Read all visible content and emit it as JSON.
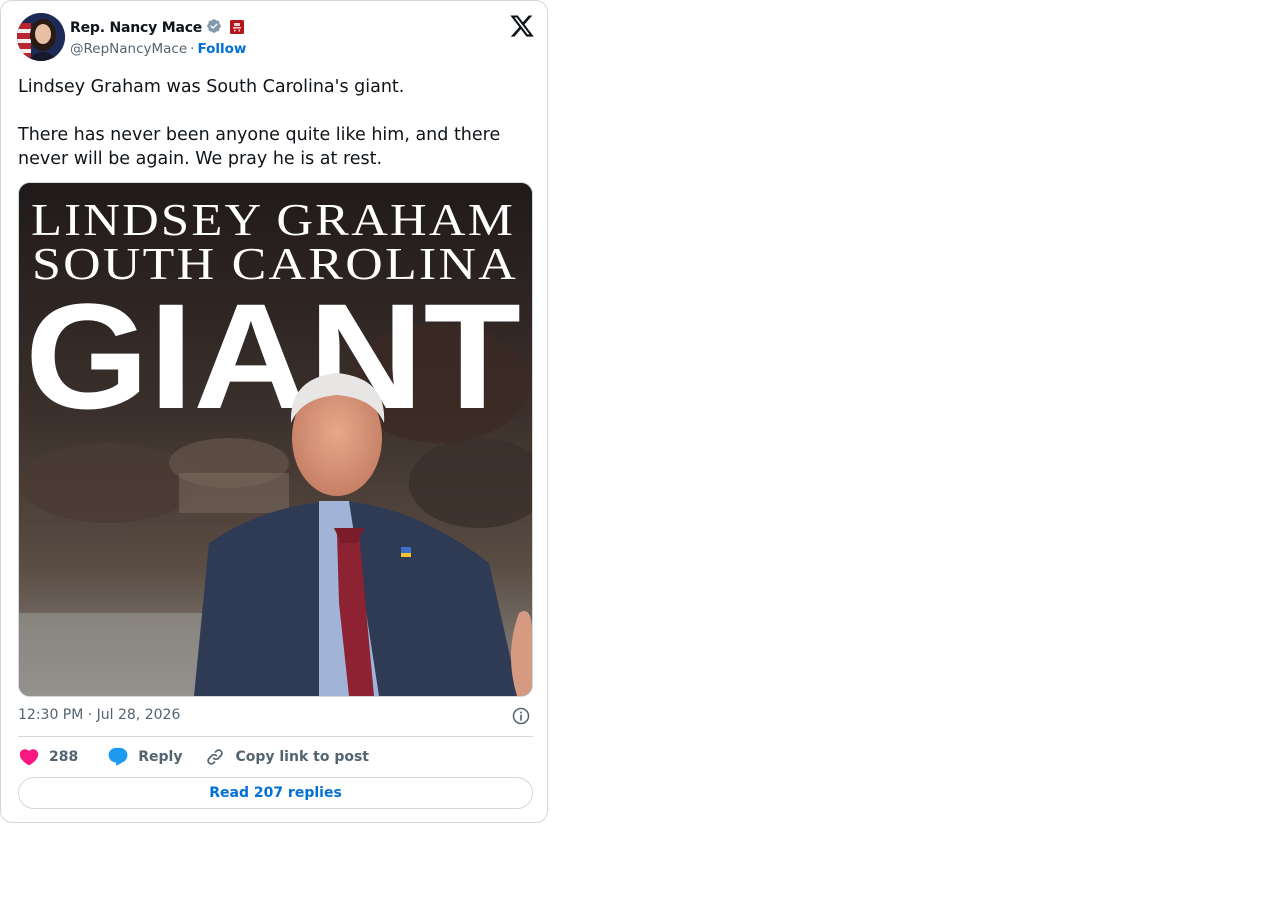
{
  "author": {
    "display_name": "Rep. Nancy Mace",
    "handle": "@RepNancyMace",
    "separator": "·",
    "follow_label": "Follow",
    "verified_badge_color": "#829aab",
    "affiliate_badge_color": "#b3151a"
  },
  "tweet": {
    "paragraphs": [
      "Lindsey Graham was South Carolina's giant.",
      "There has never been anyone quite like him, and there never will be again. We pray he is at rest."
    ],
    "media": {
      "headline_line1": "LINDSEY GRAHAM",
      "headline_line2": "SOUTH CAROLINA",
      "headline_big": "GIANT"
    },
    "timestamp": "12:30 PM · Jul 28, 2026"
  },
  "actions": {
    "like_count": "288",
    "reply_label": "Reply",
    "copy_label": "Copy link to post",
    "read_replies_label": "Read 207 replies"
  },
  "colors": {
    "link": "#006fd6",
    "like": "#f91880",
    "reply": "#1d9bf0",
    "muted": "#536471",
    "border": "#cfd9de"
  },
  "icons": [
    "x-logo-icon",
    "verified-badge-icon",
    "affiliate-badge-icon",
    "info-icon",
    "heart-icon",
    "reply-bubble-icon",
    "link-icon"
  ]
}
